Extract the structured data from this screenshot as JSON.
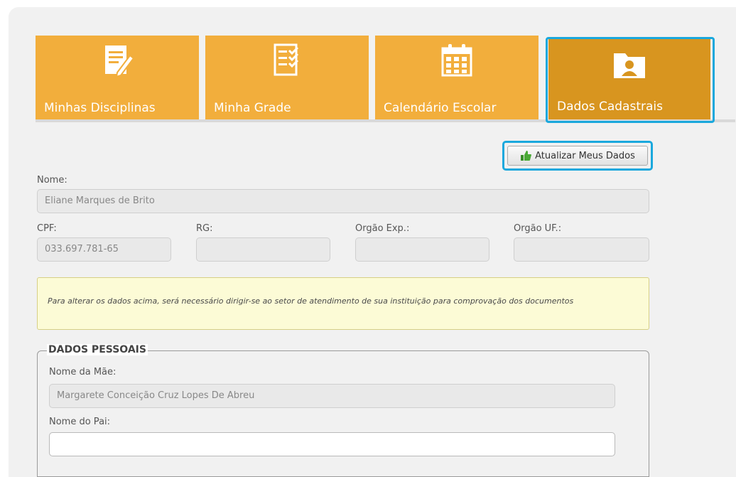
{
  "tabs": [
    {
      "label": "Minhas Disciplinas",
      "icon": "edit-document-icon"
    },
    {
      "label": "Minha Grade",
      "icon": "checklist-icon"
    },
    {
      "label": "Calendário Escolar",
      "icon": "calendar-icon"
    },
    {
      "label": "Dados Cadastrais",
      "icon": "folder-user-icon",
      "active": true
    }
  ],
  "update_button": {
    "label": "Atualizar Meus Dados",
    "icon": "thumbs-up-icon"
  },
  "form": {
    "nome_label": "Nome:",
    "nome_value": "Eliane Marques de Brito",
    "cpf_label": "CPF:",
    "cpf_value": "033.697.781-65",
    "rg_label": "RG:",
    "rg_value": "",
    "orgao_exp_label": "Orgão Exp.:",
    "orgao_exp_value": "",
    "orgao_uf_label": "Orgão UF.:",
    "orgao_uf_value": ""
  },
  "warning_text": "Para alterar os dados acima, será necessário dirigir-se ao setor de atendimento de sua instituição para comprovação dos documentos",
  "pessoais": {
    "legend": "DADOS PESSOAIS",
    "mae_label": "Nome da Mãe:",
    "mae_value": "Margarete Conceição Cruz Lopes De Abreu",
    "pai_label": "Nome do Pai:",
    "pai_value": ""
  },
  "colors": {
    "tile": "#f2ae3c",
    "tile_active": "#d8951f",
    "highlight": "#1aa8dd",
    "warning_bg": "#fcfbd6"
  }
}
